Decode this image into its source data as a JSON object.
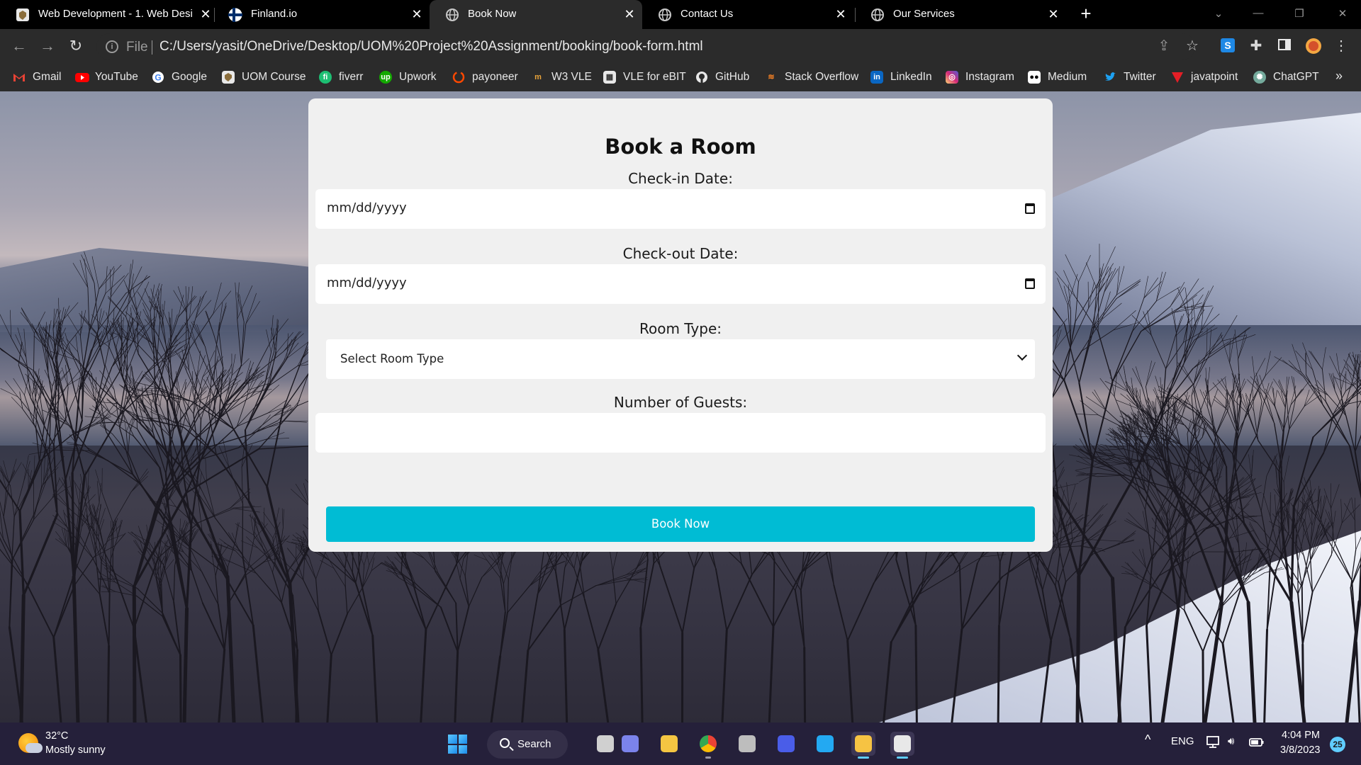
{
  "browser": {
    "tabs": [
      {
        "title": "Web Development - 1. Web Desi",
        "icon": "uom-crest-icon",
        "active": false
      },
      {
        "title": "Finland.io",
        "icon": "finland-flag-icon",
        "active": false
      },
      {
        "title": "Book Now",
        "icon": "globe-icon",
        "active": true
      },
      {
        "title": "Contact Us",
        "icon": "globe-icon",
        "active": false
      },
      {
        "title": "Our Services",
        "icon": "globe-icon",
        "active": false
      }
    ],
    "address": {
      "scheme_label": "File",
      "url": "C:/Users/yasit/OneDrive/Desktop/UOM%20Project%20Assignment/booking/book-form.html"
    },
    "bookmarks": [
      {
        "label": "Gmail",
        "icon": "gmail-icon",
        "color": "#ea4335"
      },
      {
        "label": "YouTube",
        "icon": "youtube-icon",
        "color": "#ff0000"
      },
      {
        "label": "Google",
        "icon": "google-icon",
        "color": "#4285f4"
      },
      {
        "label": "UOM Course",
        "icon": "uom-crest-icon",
        "color": "#8a7a4a"
      },
      {
        "label": "fiverr",
        "icon": "fiverr-icon",
        "color": "#1dbf73"
      },
      {
        "label": "Upwork",
        "icon": "upwork-icon",
        "color": "#14a800"
      },
      {
        "label": "payoneer",
        "icon": "payoneer-icon",
        "color": "#ff4800"
      },
      {
        "label": "W3 VLE",
        "icon": "w3vle-icon",
        "color": "#e8a33a"
      },
      {
        "label": "VLE for eBIT",
        "icon": "vle-ebit-icon",
        "color": "#6b6b6b"
      },
      {
        "label": "GitHub",
        "icon": "github-icon",
        "color": "#e8e8e8"
      },
      {
        "label": "Stack Overflow",
        "icon": "stackoverflow-icon",
        "color": "#f48024"
      },
      {
        "label": "LinkedIn",
        "icon": "linkedin-icon",
        "color": "#0a66c2"
      },
      {
        "label": "Instagram",
        "icon": "instagram-icon",
        "color": "#d62976"
      },
      {
        "label": "Medium",
        "icon": "medium-icon",
        "color": "#000000"
      },
      {
        "label": "Twitter",
        "icon": "twitter-icon",
        "color": "#1da1f2"
      },
      {
        "label": "javatpoint",
        "icon": "javatpoint-icon",
        "color": "#e41e26"
      },
      {
        "label": "ChatGPT",
        "icon": "chatgpt-icon",
        "color": "#74aa9c"
      }
    ],
    "bookmarks_overflow": "»"
  },
  "page": {
    "title": "Book a Room",
    "checkin": {
      "label": "Check-in Date:",
      "placeholder": "mm/dd/yyyy"
    },
    "checkout": {
      "label": "Check-out Date:",
      "placeholder": "mm/dd/yyyy"
    },
    "room_type": {
      "label": "Room Type:",
      "selected": "Select Room Type"
    },
    "guests": {
      "label": "Number of Guests:",
      "value": ""
    },
    "submit_label": "Book Now",
    "accent_color": "#00bcd4"
  },
  "taskbar": {
    "weather": {
      "temp": "32°C",
      "desc": "Mostly sunny"
    },
    "search_label": "Search",
    "apps": [
      {
        "name": "task-view-icon",
        "color": "#d0d0d0",
        "active": false,
        "running": false
      },
      {
        "name": "teams-chat-icon",
        "color": "#7b83eb",
        "active": false,
        "running": false
      },
      {
        "name": "file-explorer-icon",
        "color": "#f4c542",
        "active": false,
        "running": false
      },
      {
        "name": "chrome-icon",
        "color": "#34a853",
        "active": false,
        "running": true
      },
      {
        "name": "unity-icon",
        "color": "#bdbdbd",
        "active": false,
        "running": false
      },
      {
        "name": "mathworks-icon",
        "color": "#4a5de8",
        "active": false,
        "running": false
      },
      {
        "name": "vscode-icon",
        "color": "#23a9f2",
        "active": false,
        "running": false
      },
      {
        "name": "sticky-notes-icon",
        "color": "#f6c343",
        "active": true,
        "running": true
      },
      {
        "name": "snipping-tool-icon",
        "color": "#e8e8e8",
        "active": true,
        "running": true
      }
    ],
    "language": "ENG",
    "time": "4:04 PM",
    "date": "3/8/2023",
    "notifications": "25"
  }
}
